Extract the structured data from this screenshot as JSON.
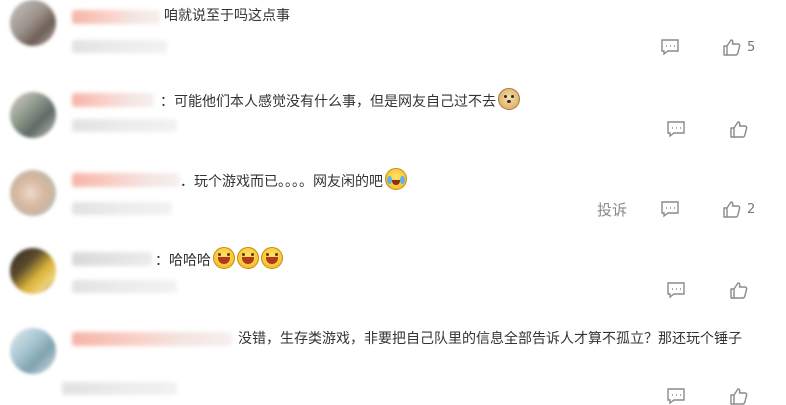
{
  "comments": [
    {
      "text": "咱就说至于吗这点事",
      "likes": "5",
      "report": ""
    },
    {
      "text": "：可能他们本人感觉没有什么事，但是网友自己过不去",
      "likes": "",
      "report": ""
    },
    {
      "text": "．玩个游戏而已。。。。网友闲的吧",
      "likes": "2",
      "report": "投诉"
    },
    {
      "text": "：哈哈哈",
      "likes": "",
      "report": ""
    },
    {
      "text": "没错，生存类游戏，非要把自己队里的信息全部告诉人才算不孤立？那还玩个锤子",
      "likes": "",
      "report": ""
    }
  ],
  "icons": {
    "reply": "comment-bubble-icon",
    "like": "thumbs-up-icon",
    "emoji_laugh": "laughing-emoji",
    "emoji_doge": "doge-emoji",
    "emoji_cry": "crying-laugh-emoji"
  },
  "colors": {
    "text": "#333333",
    "meta": "#8a8a8a",
    "name_blur": "#f6b4a8"
  }
}
